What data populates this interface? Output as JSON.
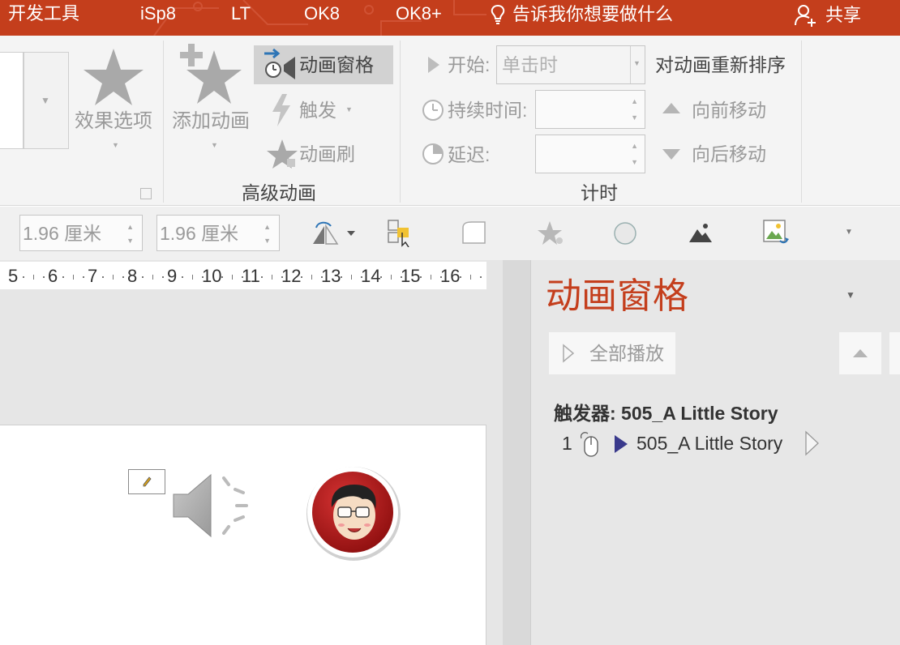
{
  "titlebar": {
    "tabs": [
      "开发工具",
      "iSp8",
      "LT",
      "OK8",
      "OK8+"
    ],
    "tell_me": "告诉我你想要做什么",
    "share": "共享"
  },
  "ribbon": {
    "effect_options": "效果选项",
    "add_animation": "添加动画",
    "animation_pane_btn": "动画窗格",
    "trigger": "触发",
    "animation_painter": "动画刷",
    "group_advanced": "高级动画",
    "start_label": "开始:",
    "start_value": "单击时",
    "duration_label": "持续时间:",
    "delay_label": "延迟:",
    "reorder_title": "对动画重新排序",
    "move_earlier": "向前移动",
    "move_later": "向后移动",
    "group_timing": "计时"
  },
  "format_bar": {
    "height_value": "1.96 厘米",
    "width_value": "1.96 厘米"
  },
  "ruler": {
    "numbers": [
      "5",
      "6",
      "7",
      "8",
      "9",
      "10",
      "11",
      "12",
      "13",
      "14",
      "15",
      "16"
    ]
  },
  "pane": {
    "title": "动画窗格",
    "play_all": "全部播放",
    "trigger_header": "触发器: 505_A Little Story",
    "item_index": "1",
    "item_name": "505_A Little Story"
  },
  "colors": {
    "accent": "#c43e1c",
    "play_arrow": "#3a3a8c"
  }
}
